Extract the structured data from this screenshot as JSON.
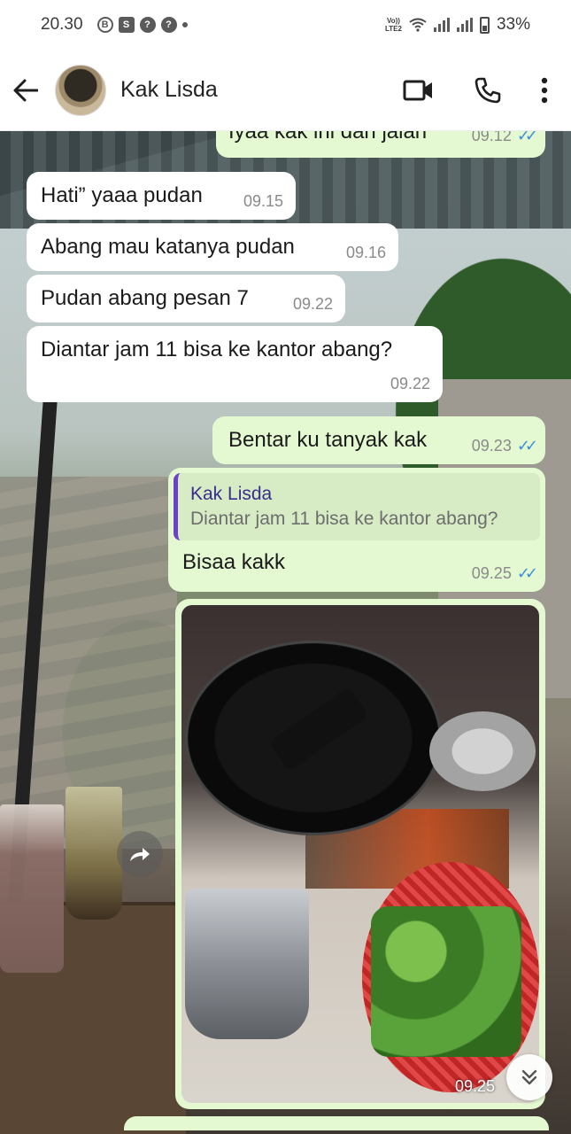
{
  "status_bar": {
    "time": "20.30",
    "network_label_top": "Vo))",
    "network_label_bottom": "LTE2",
    "battery": "33%"
  },
  "header": {
    "contact_name": "Kak Lisda",
    "icons": [
      "back-arrow-icon",
      "video-call-icon",
      "phone-icon",
      "more-vert-icon"
    ]
  },
  "messages": [
    {
      "direction": "out",
      "text": "Iyaa kak ini dah jalan",
      "time": "09.12",
      "ticks": "✓✓"
    },
    {
      "direction": "in",
      "text": "Hati” yaaa pudan",
      "time": "09.15"
    },
    {
      "direction": "in",
      "text": "Abang mau katanya pudan",
      "time": "09.16"
    },
    {
      "direction": "in",
      "text": "Pudan abang pesan 7",
      "time": "09.22"
    },
    {
      "direction": "in",
      "text": "Diantar jam 11 bisa ke kantor abang?",
      "time": "09.22"
    },
    {
      "direction": "out",
      "text": "Bentar ku tanyak kak",
      "time": "09.23",
      "ticks": "✓✓"
    },
    {
      "direction": "out",
      "quote_name": "Kak Lisda",
      "quote_text": "Diantar jam 11 bisa ke kantor abang?",
      "text": "Bisaa kakk",
      "time": "09.25",
      "ticks": "✓✓"
    },
    {
      "direction": "out",
      "type": "photo",
      "time": "09.25"
    }
  ],
  "colors": {
    "incoming_bubble": "#ffffff",
    "outgoing_bubble": "#e4f9d2",
    "read_ticks": "#3b8fd9",
    "quote_bar": "#6a41c7"
  }
}
